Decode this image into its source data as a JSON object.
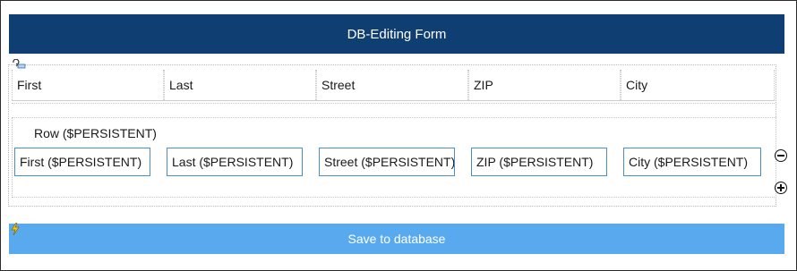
{
  "form": {
    "title": "DB-Editing Form",
    "columns": [
      "First",
      "Last",
      "Street",
      "ZIP",
      "City"
    ],
    "row_label": "Row ($PERSISTENT)",
    "fields": [
      "First ($PERSISTENT)",
      "Last ($PERSISTENT)",
      "Street ($PERSISTENT)",
      "ZIP ($PERSISTENT)",
      "City ($PERSISTENT)"
    ],
    "save_label": "Save to database"
  },
  "colors": {
    "header_bg": "#0f3e72",
    "save_bg": "#59a9ee",
    "field_border": "#4a90c8"
  },
  "icons": [
    "row-repeat-icon",
    "remove-row-icon",
    "add-row-icon",
    "lightning-icon"
  ]
}
